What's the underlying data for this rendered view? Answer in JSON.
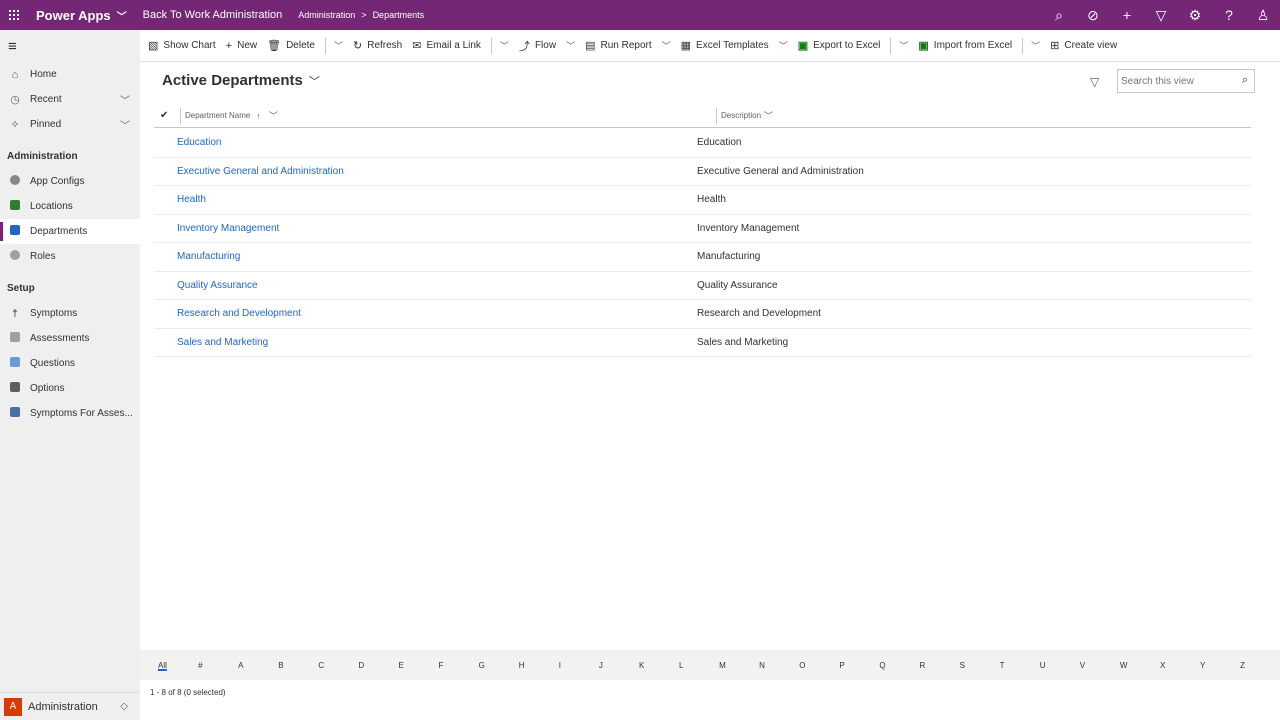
{
  "topbar": {
    "brand": "Power Apps",
    "app_name": "Back To Work Administration",
    "breadcrumb": [
      "Administration",
      "Departments"
    ],
    "breadcrumb_separator": ">",
    "colors": {
      "background": "#742774"
    }
  },
  "sidebar": {
    "top_items": [
      {
        "label": "Home",
        "icon": "home-icon"
      },
      {
        "label": "Recent",
        "icon": "clock-icon"
      },
      {
        "label": "Pinned",
        "icon": "pin-icon"
      }
    ],
    "groups": [
      {
        "header": "Administration",
        "items": [
          {
            "label": "App Configs",
            "icon": "app-configs-icon",
            "color": "#8a8886"
          },
          {
            "label": "Locations",
            "icon": "locations-icon",
            "color": "#2e7d32"
          },
          {
            "label": "Departments",
            "icon": "departments-icon",
            "color": "#2266c4",
            "selected": true
          },
          {
            "label": "Roles",
            "icon": "roles-icon",
            "color": "#a0a0a0"
          }
        ]
      },
      {
        "header": "Setup",
        "items": [
          {
            "label": "Symptoms",
            "icon": "symptoms-icon",
            "color": "#605e5c"
          },
          {
            "label": "Assessments",
            "icon": "assessments-icon",
            "color": "#a0a0a0"
          },
          {
            "label": "Questions",
            "icon": "questions-icon",
            "color": "#6b9bd2"
          },
          {
            "label": "Options",
            "icon": "options-icon",
            "color": "#605e5c"
          },
          {
            "label": "Symptoms For Asses...",
            "icon": "symptoms-for-assessments-icon",
            "color": "#4a6fa5"
          }
        ]
      }
    ],
    "area": {
      "initial": "A",
      "label": "Administration"
    }
  },
  "commandbar": {
    "show_chart": "Show Chart",
    "new": "New",
    "delete": "Delete",
    "refresh": "Refresh",
    "email_link": "Email a Link",
    "flow": "Flow",
    "run_report": "Run Report",
    "excel_templates": "Excel Templates",
    "export_excel": "Export to Excel",
    "import_excel": "Import from Excel",
    "create_view": "Create view"
  },
  "view": {
    "title": "Active Departments",
    "search_placeholder": "Search this view"
  },
  "grid": {
    "columns": [
      "Department Name",
      "Description"
    ],
    "rows": [
      {
        "name": "Education",
        "description": "Education"
      },
      {
        "name": "Executive General and Administration",
        "description": "Executive General and Administration"
      },
      {
        "name": "Health",
        "description": "Health"
      },
      {
        "name": "Inventory Management",
        "description": "Inventory Management"
      },
      {
        "name": "Manufacturing",
        "description": "Manufacturing"
      },
      {
        "name": "Quality Assurance",
        "description": "Quality Assurance"
      },
      {
        "name": "Research and Development",
        "description": "Research and Development"
      },
      {
        "name": "Sales and Marketing",
        "description": "Sales and Marketing"
      }
    ]
  },
  "jumpbar": {
    "letters": [
      "All",
      "#",
      "A",
      "B",
      "C",
      "D",
      "E",
      "F",
      "G",
      "H",
      "I",
      "J",
      "K",
      "L",
      "M",
      "N",
      "O",
      "P",
      "Q",
      "R",
      "S",
      "T",
      "U",
      "V",
      "W",
      "X",
      "Y",
      "Z"
    ],
    "active": "All"
  },
  "status": "1 - 8 of 8 (0 selected)"
}
